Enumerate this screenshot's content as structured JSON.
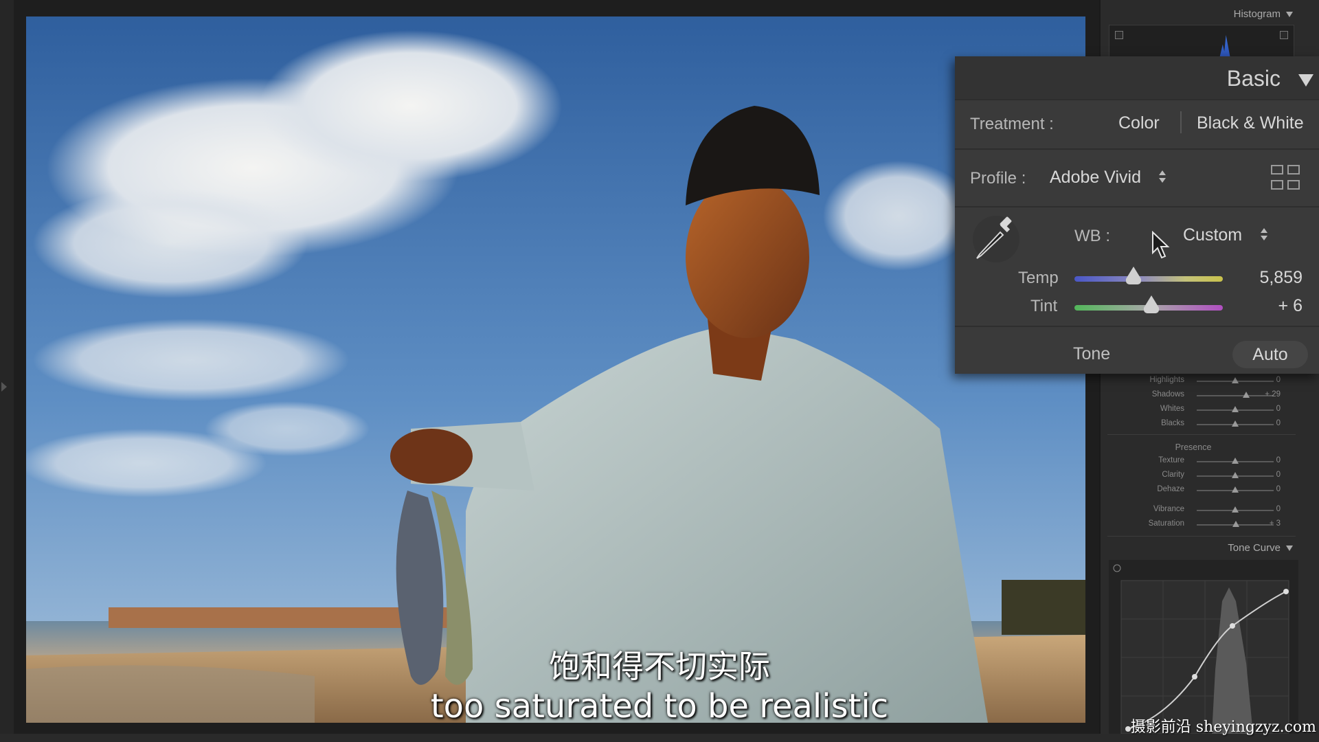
{
  "subtitles": {
    "chinese": "饱和得不切实际",
    "english": "too saturated to be realistic"
  },
  "watermark": "摄影前沿 sheyingzyz.com",
  "right_panel": {
    "histogram_label": "Histogram",
    "tone_rows": [
      {
        "label": "Highlights",
        "value": "0",
        "level": 0.5
      },
      {
        "label": "Shadows",
        "value": "+ 29",
        "level": 0.64
      },
      {
        "label": "Whites",
        "value": "0",
        "level": 0.5
      },
      {
        "label": "Blacks",
        "value": "0",
        "level": 0.5
      }
    ],
    "presence_label": "Presence",
    "presence_rows": [
      {
        "label": "Texture",
        "value": "0",
        "level": 0.5
      },
      {
        "label": "Clarity",
        "value": "0",
        "level": 0.5
      },
      {
        "label": "Dehaze",
        "value": "0",
        "level": 0.5
      }
    ],
    "color_rows": [
      {
        "label": "Vibrance",
        "value": "0",
        "level": 0.5
      },
      {
        "label": "Saturation",
        "value": "+ 3",
        "level": 0.51
      }
    ],
    "tone_curve_label": "Tone Curve"
  },
  "basic_panel": {
    "title": "Basic",
    "treatment_label": "Treatment :",
    "treatment_options": [
      "Color",
      "Black & White"
    ],
    "profile_label": "Profile :",
    "profile_value": "Adobe Vivid",
    "wb_label": "WB :",
    "wb_value": "Custom",
    "temp_label": "Temp",
    "temp_value": "5,859",
    "temp_level": 0.4,
    "tint_label": "Tint",
    "tint_value": "+ 6",
    "tint_level": 0.52,
    "tone_label": "Tone",
    "auto_label": "Auto"
  },
  "colors": {
    "panel_bg": "#3a3a3a",
    "sky_top": "#3f6fae",
    "sky_bottom": "#8fb4d8"
  }
}
